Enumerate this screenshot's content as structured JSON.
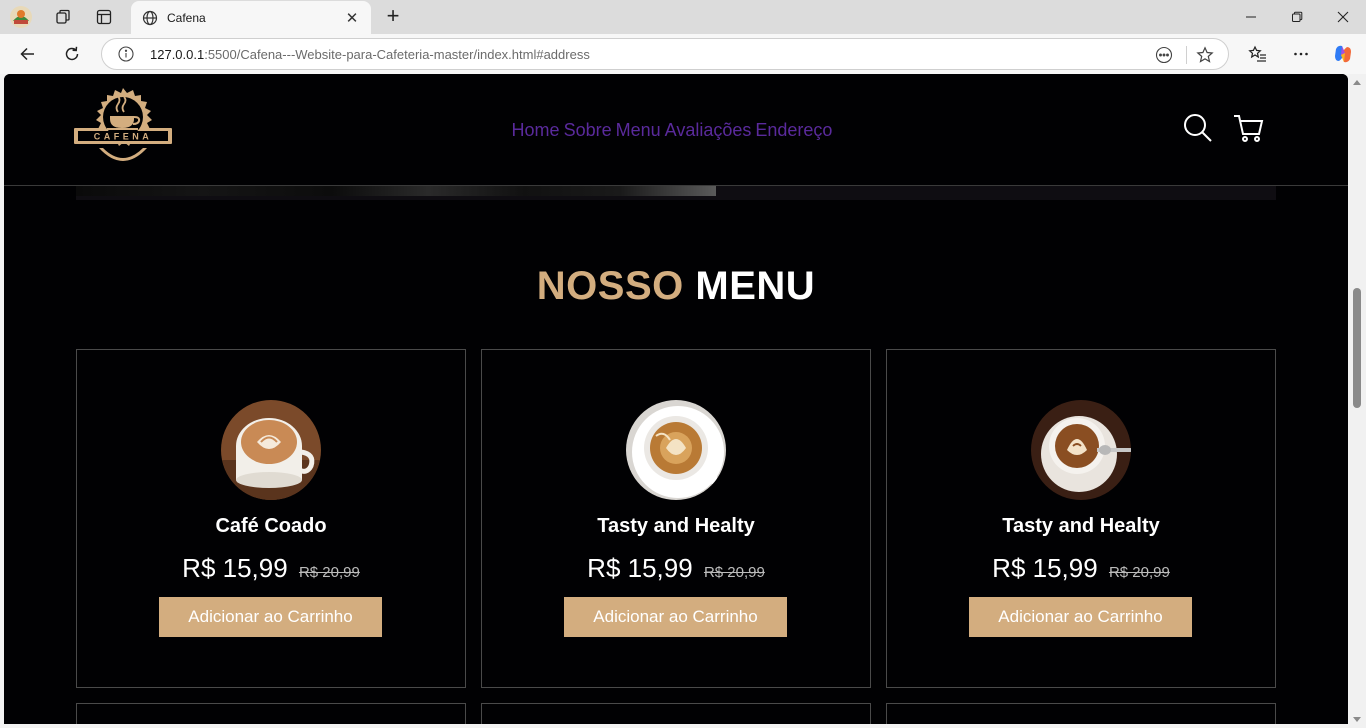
{
  "browser": {
    "tab_title": "Cafena",
    "tab_close": "✕",
    "new_tab": "+",
    "url_host": "127.0.0.1",
    "url_path": ":5500/Cafena---Website-para-Cafeteria-master/index.html#address"
  },
  "site": {
    "logo_text": "CAFENA",
    "nav": [
      "Home",
      "Sobre",
      "Menu",
      "Avaliações",
      "Endereço"
    ],
    "section_title_accent": "NOSSO",
    "section_title_rest": "MENU"
  },
  "menu_items": [
    {
      "name": "Café Coado",
      "price": "R$ 15,99",
      "old_price": "R$ 20,99",
      "button": "Adicionar ao Carrinho"
    },
    {
      "name": "Tasty and Healty",
      "price": "R$ 15,99",
      "old_price": "R$ 20,99",
      "button": "Adicionar ao Carrinho"
    },
    {
      "name": "Tasty and Healty",
      "price": "R$ 15,99",
      "old_price": "R$ 20,99",
      "button": "Adicionar ao Carrinho"
    }
  ],
  "colors": {
    "accent": "#d3ad7f",
    "nav_link": "#5a2a9c",
    "page_bg": "#010103",
    "card_border": "#4a4a4a"
  }
}
